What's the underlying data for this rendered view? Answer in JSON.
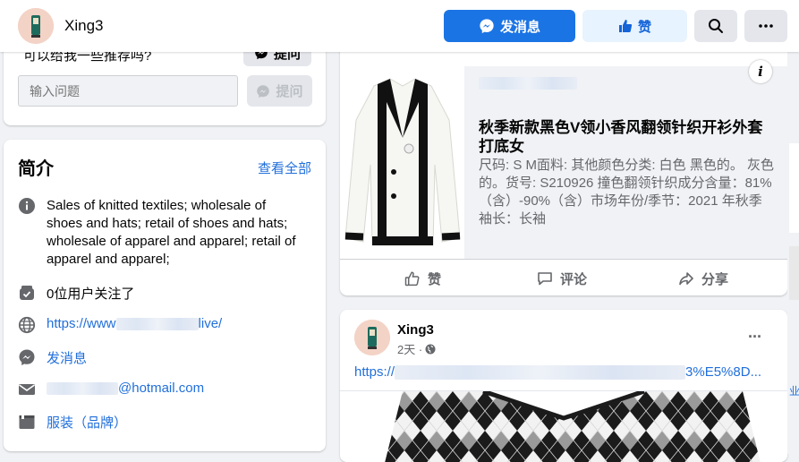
{
  "header": {
    "page_name": "Xing3",
    "message_label": "发消息",
    "like_label": "赞",
    "colors": {
      "primary": "#1b74e4",
      "light_blue": "#e7f3ff",
      "gray_btn": "#e4e6eb"
    }
  },
  "ask": {
    "question_text": "可以给我一些推荐吗?",
    "ask_label": "提问",
    "input_placeholder": "输入问题",
    "ask_label_2": "提问"
  },
  "intro": {
    "title": "简介",
    "see_all": "查看全部",
    "description": "Sales of knitted textiles; wholesale of shoes and hats; retail of shoes and hats; wholesale of apparel and apparel; retail of apparel and apparel;",
    "followers": "0位用户关注了",
    "website_prefix": "https://www",
    "website_suffix": "live/",
    "messenger": "发消息",
    "email_suffix": "@hotmail.com",
    "category": "服装（品牌）"
  },
  "product_post": {
    "info_icon": "i",
    "title": "秋季新款黑色V领小香风翻领针织开衫外套打底女",
    "description": "尺码: S M面料: 其他颜色分类: 白色 黑色的。 灰色的。货号: S210926 撞色翻领针织成分含量：81%（含）-90%（含）市场年份/季节：2021 年秋季 袖长：长袖",
    "like": "赞",
    "comment": "评论",
    "share": "分享"
  },
  "post": {
    "author": "Xing3",
    "time": "2天 ·",
    "link_prefix": "https://",
    "link_suffix": "3%E5%8D...",
    "more": "···"
  },
  "right_edge": {
    "text": "业"
  }
}
